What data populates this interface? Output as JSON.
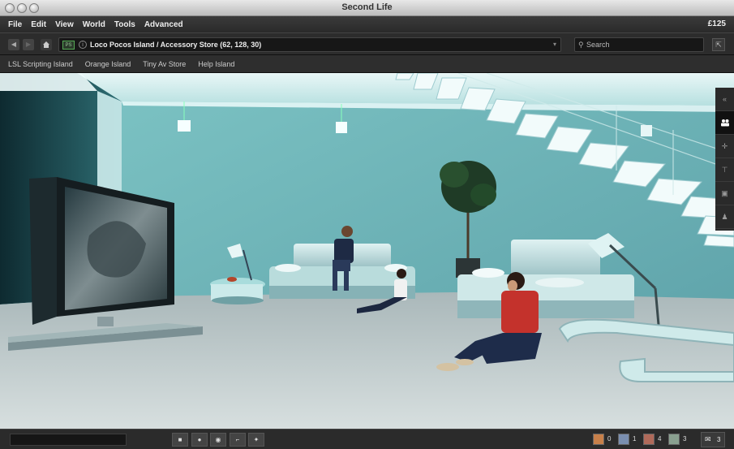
{
  "window": {
    "title": "Second Life"
  },
  "menu": {
    "items": [
      "File",
      "Edit",
      "View",
      "World",
      "Tools",
      "Advanced"
    ],
    "balance": "£125"
  },
  "nav": {
    "back_icon": "back-arrow-icon",
    "forward_icon": "forward-arrow-icon",
    "home_icon": "home-icon",
    "parcel_badge": "PS",
    "location": "Loco Pocos Island / Accessory Store (62, 128, 30)",
    "search_placeholder": "Search"
  },
  "favorites": [
    "LSL Scripting Island",
    "Orange Island",
    "Tiny Av Store",
    "Help Island"
  ],
  "sidebar": {
    "tabs": [
      "collapse-icon",
      "people-icon",
      "places-icon",
      "landmark-icon",
      "inventory-icon",
      "profile-icon"
    ],
    "active": "people-icon"
  },
  "bottom": {
    "tools": [
      "stop-icon",
      "record-icon",
      "camera-icon",
      "corner-icon",
      "move-icon"
    ],
    "counts": [
      {
        "value": "0",
        "color": "#c8804a"
      },
      {
        "value": "1",
        "color": "#7b8fb0"
      },
      {
        "value": "4",
        "color": "#b06a5a"
      },
      {
        "value": "3",
        "color": "#8aa090"
      }
    ],
    "messages": "3"
  }
}
